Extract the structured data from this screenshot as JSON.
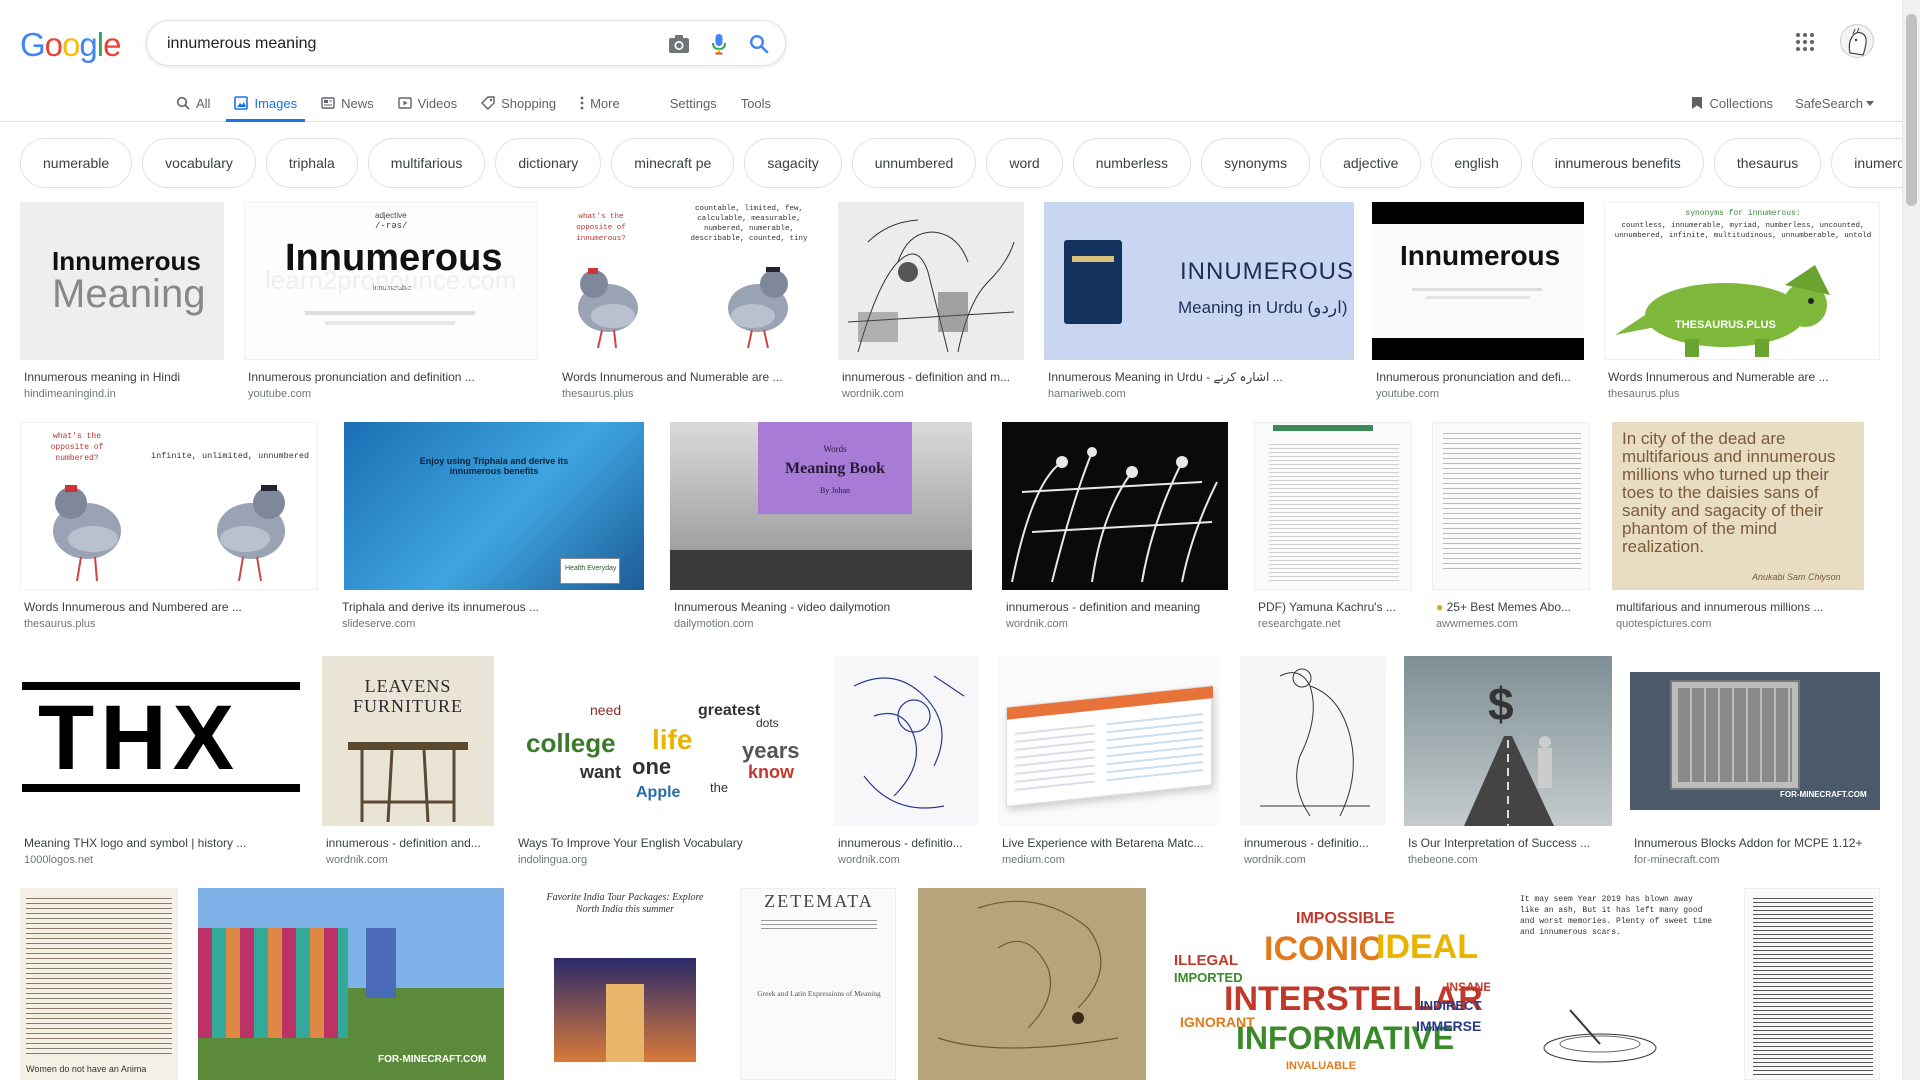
{
  "search": {
    "query": "innumerous meaning"
  },
  "logo": {
    "letters": [
      "G",
      "o",
      "o",
      "g",
      "l",
      "e"
    ],
    "colors": [
      "#4285f4",
      "#ea4335",
      "#fbbc05",
      "#4285f4",
      "#34a853",
      "#ea4335"
    ]
  },
  "colors": {
    "accent": "#1a73e8",
    "text": "#202124",
    "muted": "#5f6368",
    "border": "#dfe1e5"
  },
  "tabs": [
    {
      "label": "All",
      "icon": "search-icon"
    },
    {
      "label": "Images",
      "icon": "image-icon",
      "active": true
    },
    {
      "label": "News",
      "icon": "news-icon"
    },
    {
      "label": "Videos",
      "icon": "video-icon"
    },
    {
      "label": "Shopping",
      "icon": "tag-icon"
    },
    {
      "label": "More",
      "icon": "more-vert-icon"
    }
  ],
  "tools": {
    "settings": "Settings",
    "tools": "Tools"
  },
  "right": {
    "collections": "Collections",
    "safesearch": "SafeSearch"
  },
  "chips": [
    "numerable",
    "vocabulary",
    "triphala",
    "multifarious",
    "dictionary",
    "minecraft pe",
    "sagacity",
    "unnumbered",
    "word",
    "numberless",
    "synonyms",
    "adjective",
    "english",
    "innumerous benefits",
    "thesaurus",
    "inumerous"
  ],
  "thumb_text": {
    "t1": "Innumerous",
    "t1b": "Meaning",
    "t2_pos": "adjective",
    "t2_pron": "/-rəs/",
    "t2_word": "Innumerous",
    "t2_sub": "innumerable",
    "t2_wm": "learn2pronounce.com",
    "t3_q": "what's the opposite of innumerous?",
    "t3_a": "countable, limited, few, calculable, measurable, numbered, numerable, describable, counted, tiny",
    "t5_title": "INNUMEROUS",
    "t5_sub": "Meaning in Urdu (اردو)",
    "t7_word": "Innumerous",
    "t8_head": "synonyms for innumerous:",
    "t8_body": "countless, innumerable, myriad, numberless, uncounted, unnumbered, infinite, multitudinous, unnumberable, untold",
    "t8_wm": "THESAURUS.PLUS",
    "t9_q": "what's the opposite of numbered?",
    "t9_a": "infinite, unlimited, unnumbered",
    "t10_text": "Enjoy using Triphala and derive its innumerous benefits",
    "t10_logo": "Health Everyday",
    "t11_a": "Words",
    "t11_b": "Meaning Book",
    "t11_c": "By Johan",
    "t15_q": "In city of the dead are multifarious and innumerous millions who turned up their toes to the daisies sans of sanity and sagacity of their phantom of the mind realization.",
    "t15_by": "Anukabi Sam Chiyson",
    "t16": "THX",
    "t17": "LEAVENS FURNITURE",
    "t23": "FOR-MINECRAFT.COM",
    "t24_cap": "Women do not have an Anima",
    "t26_title": "Favorite India Tour Packages: Explore North India this summer",
    "t27_title": "ZETEMATA",
    "t27_sub": "Greek and Latin Expressions of Meaning",
    "t30_poem": "It may seem Year 2019 has blown away like an ash, But it has left many good and worst memories. Plenty of sweet time and innumerous scars."
  },
  "wordcloud": {
    "w1": [
      "college",
      "life",
      "want",
      "one",
      "years",
      "know",
      "Apple",
      "dots",
      "greatest",
      "need",
      "the"
    ],
    "w2": [
      "ICONIC",
      "IDEAL",
      "INTERSTELLAR",
      "INFORMATIVE",
      "IMPOSSIBLE",
      "ILLEGAL",
      "IMPORTED",
      "IMMERSE",
      "IGNORANT",
      "INDIRECT",
      "INSANE",
      "INVALUABLE"
    ]
  },
  "results": [
    {
      "caption": "Innumerous meaning in Hindi",
      "source": "hindimeaningind.in"
    },
    {
      "caption": "Innumerous pronunciation and definition ...",
      "source": "youtube.com"
    },
    {
      "caption": "Words Innumerous and Numerable are ...",
      "source": "thesaurus.plus"
    },
    {
      "caption": "innumerous - definition and m...",
      "source": "wordnik.com"
    },
    {
      "caption": "Innumerous Meaning in Urdu - اشارہ کرنے ...",
      "source": "hamariweb.com"
    },
    {
      "caption": "Innumerous pronunciation and defi...",
      "source": "youtube.com"
    },
    {
      "caption": "Words Innumerous and Numerable are ...",
      "source": "thesaurus.plus"
    },
    {
      "caption": "Words Innumerous and Numbered are ...",
      "source": "thesaurus.plus"
    },
    {
      "caption": "Triphala and derive its innumerous ...",
      "source": "slideserve.com"
    },
    {
      "caption": "Innumerous Meaning - video dailymotion",
      "source": "dailymotion.com"
    },
    {
      "caption": "innumerous - definition and meaning",
      "source": "wordnik.com"
    },
    {
      "caption": "PDF) Yamuna Kachru's ...",
      "source": "researchgate.net"
    },
    {
      "caption": "25+ Best Memes Abo...",
      "source": "awwmemes.com"
    },
    {
      "caption": "multifarious and innumerous millions ...",
      "source": "quotespictures.com"
    },
    {
      "caption": "Meaning THX logo and symbol | history ...",
      "source": "1000logos.net"
    },
    {
      "caption": "innumerous - definition and...",
      "source": "wordnik.com"
    },
    {
      "caption": "Ways To Improve Your English Vocabulary",
      "source": "indolingua.org"
    },
    {
      "caption": "innumerous - definitio...",
      "source": "wordnik.com"
    },
    {
      "caption": "Live Experience with Betarena Matc...",
      "source": "medium.com"
    },
    {
      "caption": "innumerous - definitio...",
      "source": "wordnik.com"
    },
    {
      "caption": "Is Our Interpretation of Success ...",
      "source": "thebeone.com"
    },
    {
      "caption": "Innumerous Blocks Addon for MCPE 1.12+",
      "source": "for-minecraft.com"
    }
  ]
}
